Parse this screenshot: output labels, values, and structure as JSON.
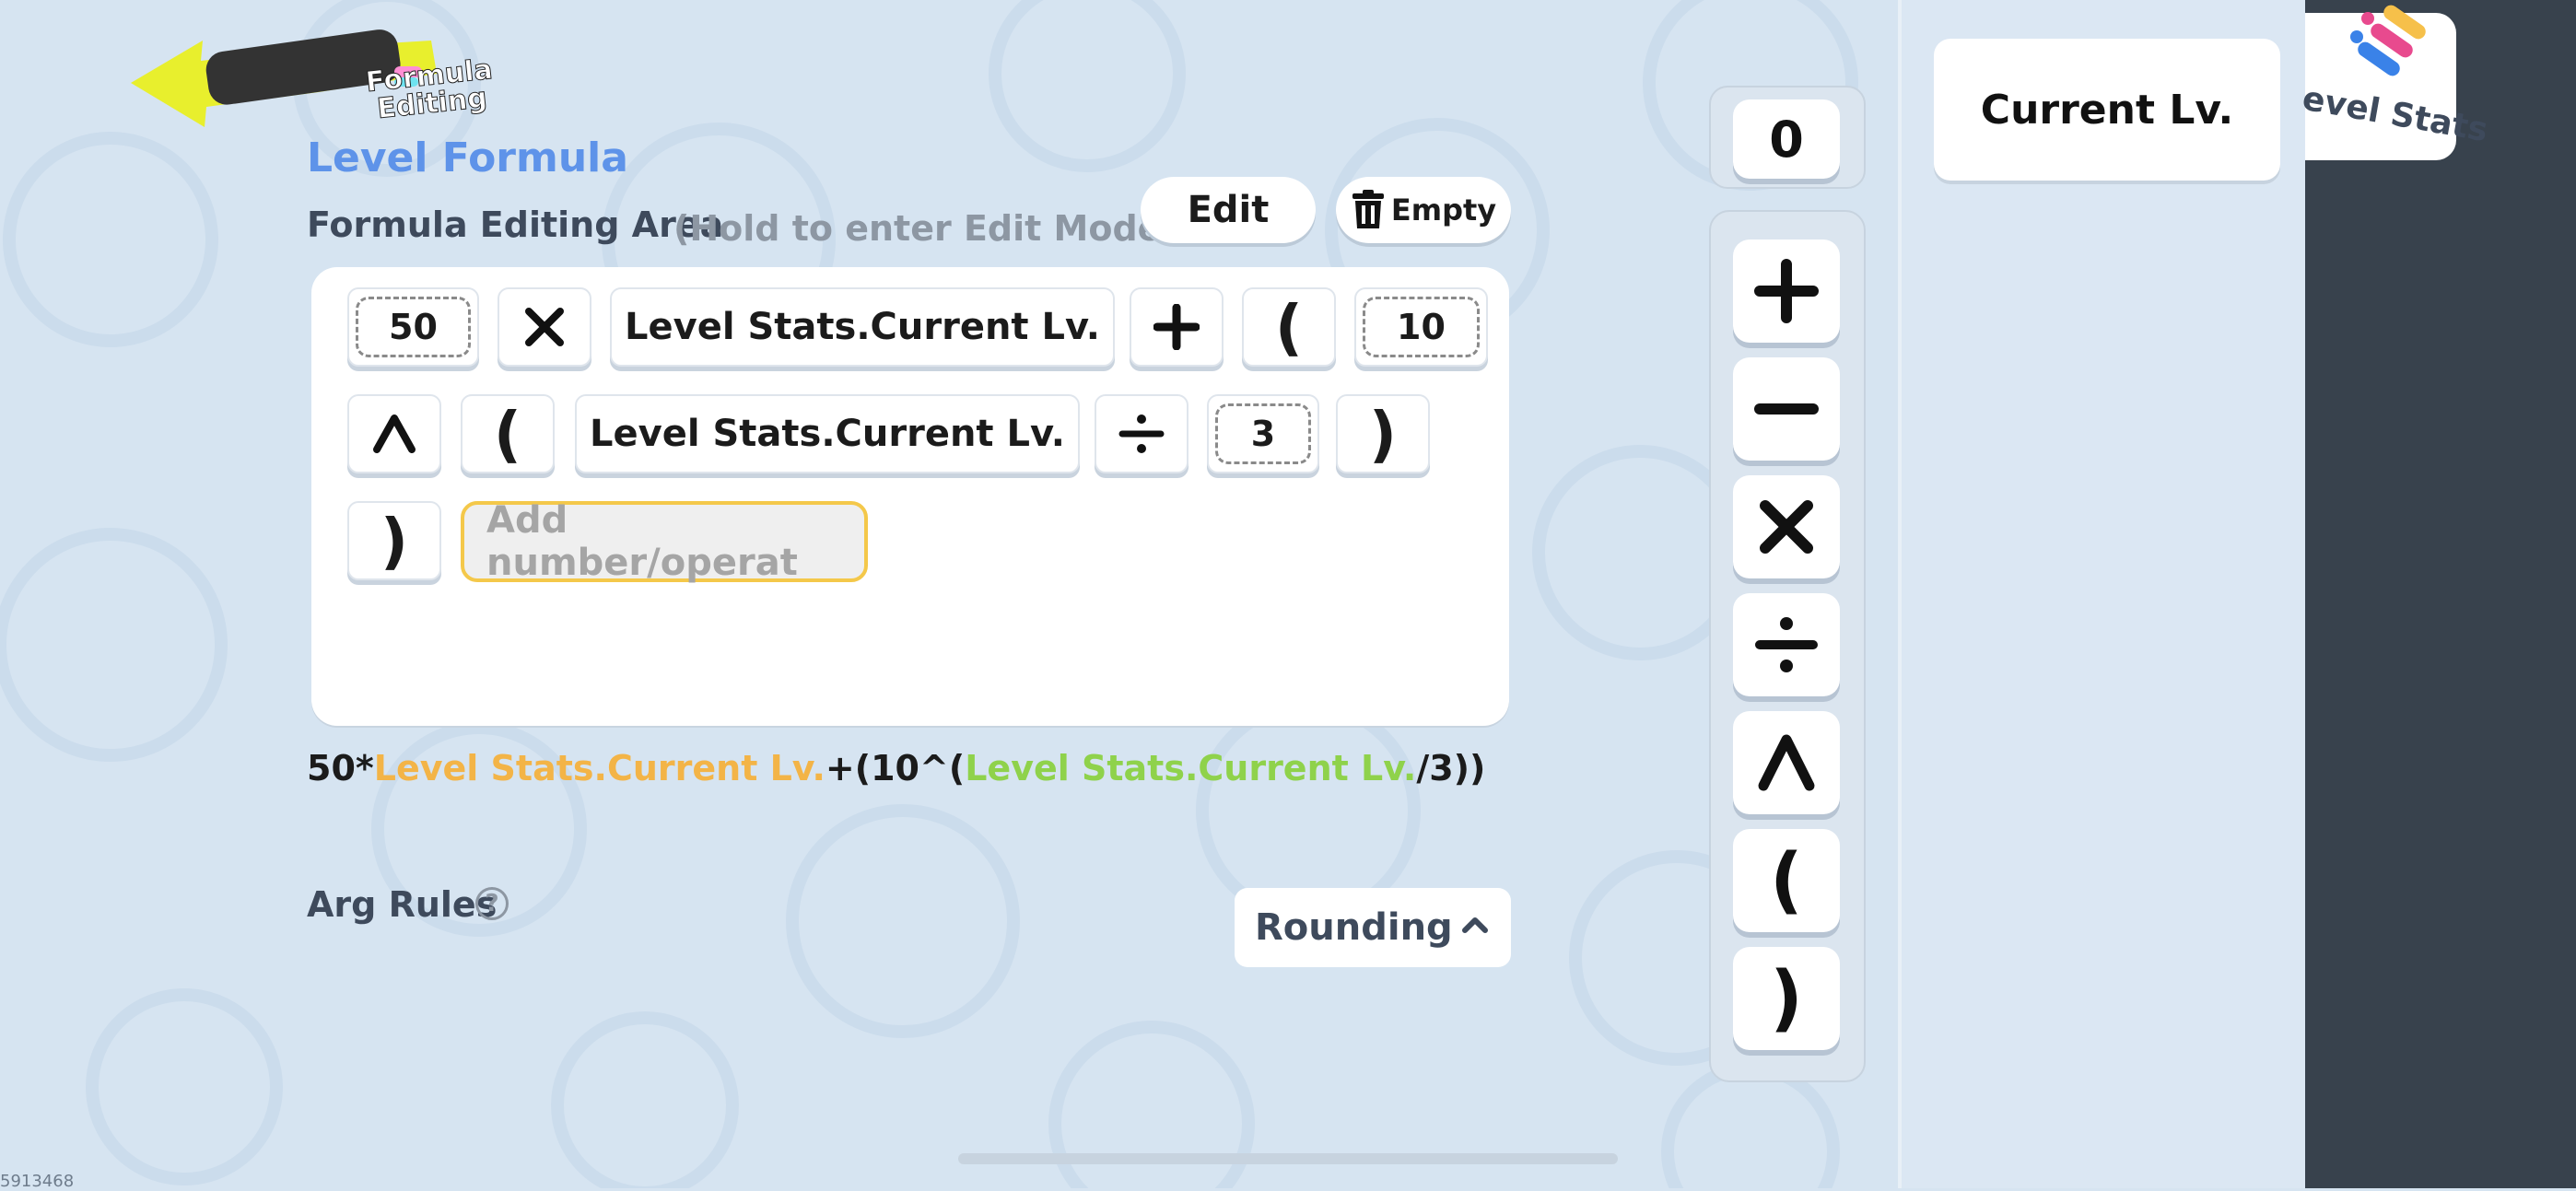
{
  "header": {
    "back_label_line1": "Formula",
    "back_label_line2": "Editing"
  },
  "editor": {
    "title": "Level Formula",
    "area_label": "Formula Editing Area",
    "area_hint": "(Hold to enter Edit Mode)",
    "edit_label": "Edit",
    "empty_label": "Empty",
    "tokens": {
      "num_50": "50",
      "var_1": "Level Stats.Current Lv.",
      "paren_open_1": "(",
      "num_10": "10",
      "paren_open_2": "(",
      "var_2": "Level Stats.Current Lv.",
      "num_3": "3",
      "paren_close_1": ")",
      "paren_close_2": ")"
    },
    "input_placeholder": "Add number/operat"
  },
  "preview": {
    "part1": "50*",
    "var1": "Level Stats.Current Lv.",
    "part2": "+(10^(",
    "var2": "Level Stats.Current Lv.",
    "part3": "/3))"
  },
  "arg_rules": {
    "label": "Arg Rules",
    "help": "?",
    "select_value": "Rounding"
  },
  "keypad": {
    "zero": "0",
    "keys": [
      "plus",
      "minus",
      "multiply",
      "divide",
      "power",
      "(",
      ")"
    ],
    "paren_open": "(",
    "paren_close": ")"
  },
  "right_panel": {
    "current_card": "Current Lv.",
    "tab_label": "evel Stats"
  },
  "footer": {
    "id": "5913468"
  },
  "colors": {
    "title": "#5e93e9",
    "var_orange": "#f3b447",
    "var_green": "#8fd24b",
    "input_border": "#f4c84a",
    "dark_panel": "#38424d",
    "background": "#d6e4f1"
  }
}
